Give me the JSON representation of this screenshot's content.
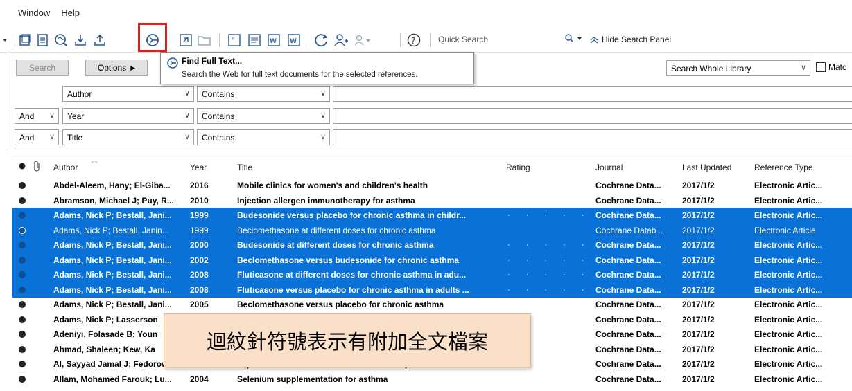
{
  "menu": {
    "items": [
      "Window",
      "Help"
    ]
  },
  "toolbar": {
    "quick_search_placeholder": "Quick Search",
    "hide_search_panel": "Hide Search Panel",
    "icons": [
      "new-group-icon",
      "new-reference-icon",
      "online-search-icon",
      "import-icon",
      "export-icon",
      "find-full-text-icon",
      "open-link-icon",
      "open-file-icon",
      "insert-citation-icon",
      "format-bibliography-icon",
      "word-icon",
      "sync-icon",
      "share-icon",
      "group-users-icon",
      "help-icon",
      "search-icon"
    ]
  },
  "tooltip": {
    "title": "Find Full Text...",
    "description": "Search the Web for full text documents for the selected references."
  },
  "search_panel": {
    "search_button": "Search",
    "options_button": "Options",
    "scope": "Search Whole Library",
    "match_case_label": "Matc",
    "rows": [
      {
        "bool": "",
        "field": "Author",
        "op": "Contains"
      },
      {
        "bool": "And",
        "field": "Year",
        "op": "Contains"
      },
      {
        "bool": "And",
        "field": "Title",
        "op": "Contains"
      }
    ]
  },
  "table": {
    "columns": [
      "Author",
      "Year",
      "Title",
      "Rating",
      "Journal",
      "Last Updated",
      "Reference Type"
    ],
    "rows": [
      {
        "author": "Abdel-Aleem, Hany; El-Giba...",
        "year": "2016",
        "title": "Mobile clinics for women's and children's health",
        "rating": "",
        "journal": "Cochrane Data...",
        "updated": "2017/1/2",
        "type": "Electronic Artic...",
        "selected": false,
        "bold": true,
        "hollow": false
      },
      {
        "author": "Abramson, Michael J; Puy, R...",
        "year": "2010",
        "title": "Injection allergen immunotherapy for asthma",
        "rating": "",
        "journal": "Cochrane Data...",
        "updated": "2017/1/2",
        "type": "Electronic Artic...",
        "selected": false,
        "bold": true,
        "hollow": false
      },
      {
        "author": "Adams, Nick P; Bestall, Jani...",
        "year": "1999",
        "title": "Budesonide versus placebo for chronic asthma in childr...",
        "rating": "· · · · ·",
        "journal": "Cochrane Data...",
        "updated": "2017/1/2",
        "type": "Electronic Artic...",
        "selected": true,
        "bold": true,
        "hollow": false
      },
      {
        "author": "Adams, Nick P; Bestall, Janin...",
        "year": "1999",
        "title": "Beclomethasone at different doses for chronic asthma",
        "rating": "",
        "journal": "Cochrane Datab...",
        "updated": "2017/1/2",
        "type": "Electronic Article",
        "selected": true,
        "bold": false,
        "hollow": true
      },
      {
        "author": "Adams, Nick P; Bestall, Jani...",
        "year": "2000",
        "title": "Budesonide at different doses for chronic asthma",
        "rating": "· · · · ·",
        "journal": "Cochrane Data...",
        "updated": "2017/1/2",
        "type": "Electronic Artic...",
        "selected": true,
        "bold": true,
        "hollow": false
      },
      {
        "author": "Adams, Nick P; Bestall, Jani...",
        "year": "2002",
        "title": "Beclomethasone versus budesonide for chronic asthma",
        "rating": "· · · · ·",
        "journal": "Cochrane Data...",
        "updated": "2017/1/2",
        "type": "Electronic Artic...",
        "selected": true,
        "bold": true,
        "hollow": false
      },
      {
        "author": "Adams, Nick P; Bestall, Jani...",
        "year": "2008",
        "title": "Fluticasone at different doses for chronic asthma in adu...",
        "rating": "· · · · ·",
        "journal": "Cochrane Data...",
        "updated": "2017/1/2",
        "type": "Electronic Artic...",
        "selected": true,
        "bold": true,
        "hollow": false
      },
      {
        "author": "Adams, Nick P; Bestall, Jani...",
        "year": "2008",
        "title": "Fluticasone versus placebo for chronic asthma in adults ...",
        "rating": "· · · · ·",
        "journal": "Cochrane Data...",
        "updated": "2017/1/2",
        "type": "Electronic Artic...",
        "selected": true,
        "bold": true,
        "hollow": false
      },
      {
        "author": "Adams, Nick P; Bestall, Jani...",
        "year": "2005",
        "title": "Beclomethasone versus placebo for chronic asthma",
        "rating": "",
        "journal": "Cochrane Data...",
        "updated": "2017/1/2",
        "type": "Electronic Artic...",
        "selected": false,
        "bold": true,
        "hollow": false
      },
      {
        "author": "Adams, Nick P; Lasserson",
        "year": "",
        "title": "",
        "rating": "",
        "journal": "Cochrane Data...",
        "updated": "2017/1/2",
        "type": "Electronic Artic...",
        "selected": false,
        "bold": true,
        "hollow": false
      },
      {
        "author": "Adeniyi, Folasade B; Youn",
        "year": "",
        "title": "",
        "rating": "",
        "journal": "Cochrane Data...",
        "updated": "2017/1/2",
        "type": "Electronic Artic...",
        "selected": false,
        "bold": true,
        "hollow": false
      },
      {
        "author": "Ahmad, Shaleen; Kew, Ka",
        "year": "",
        "title": "",
        "rating": "",
        "journal": "Cochrane Data...",
        "updated": "2017/1/2",
        "type": "Electronic Artic...",
        "selected": false,
        "bold": true,
        "hollow": false
      },
      {
        "author": "Al, Sayyad Jamal J; Fedorow...",
        "year": "2007",
        "title": "Topical nasal steroids for intermittent and persistent all...",
        "rating": "",
        "journal": "Cochrane Data...",
        "updated": "2017/1/2",
        "type": "Electronic Artic...",
        "selected": false,
        "bold": true,
        "hollow": false
      },
      {
        "author": "Allam, Mohamed Farouk; Lu...",
        "year": "2004",
        "title": "Selenium supplementation for asthma",
        "rating": "",
        "journal": "Cochrane Data...",
        "updated": "2017/1/2",
        "type": "Electronic Artic...",
        "selected": false,
        "bold": true,
        "hollow": false
      }
    ]
  },
  "callout": {
    "text": "迴紋針符號表示有附加全文檔案"
  },
  "colors": {
    "selection": "#0a72d6",
    "highlight_box": "#e21b1b",
    "callout_bg": "#fbe0c9"
  }
}
